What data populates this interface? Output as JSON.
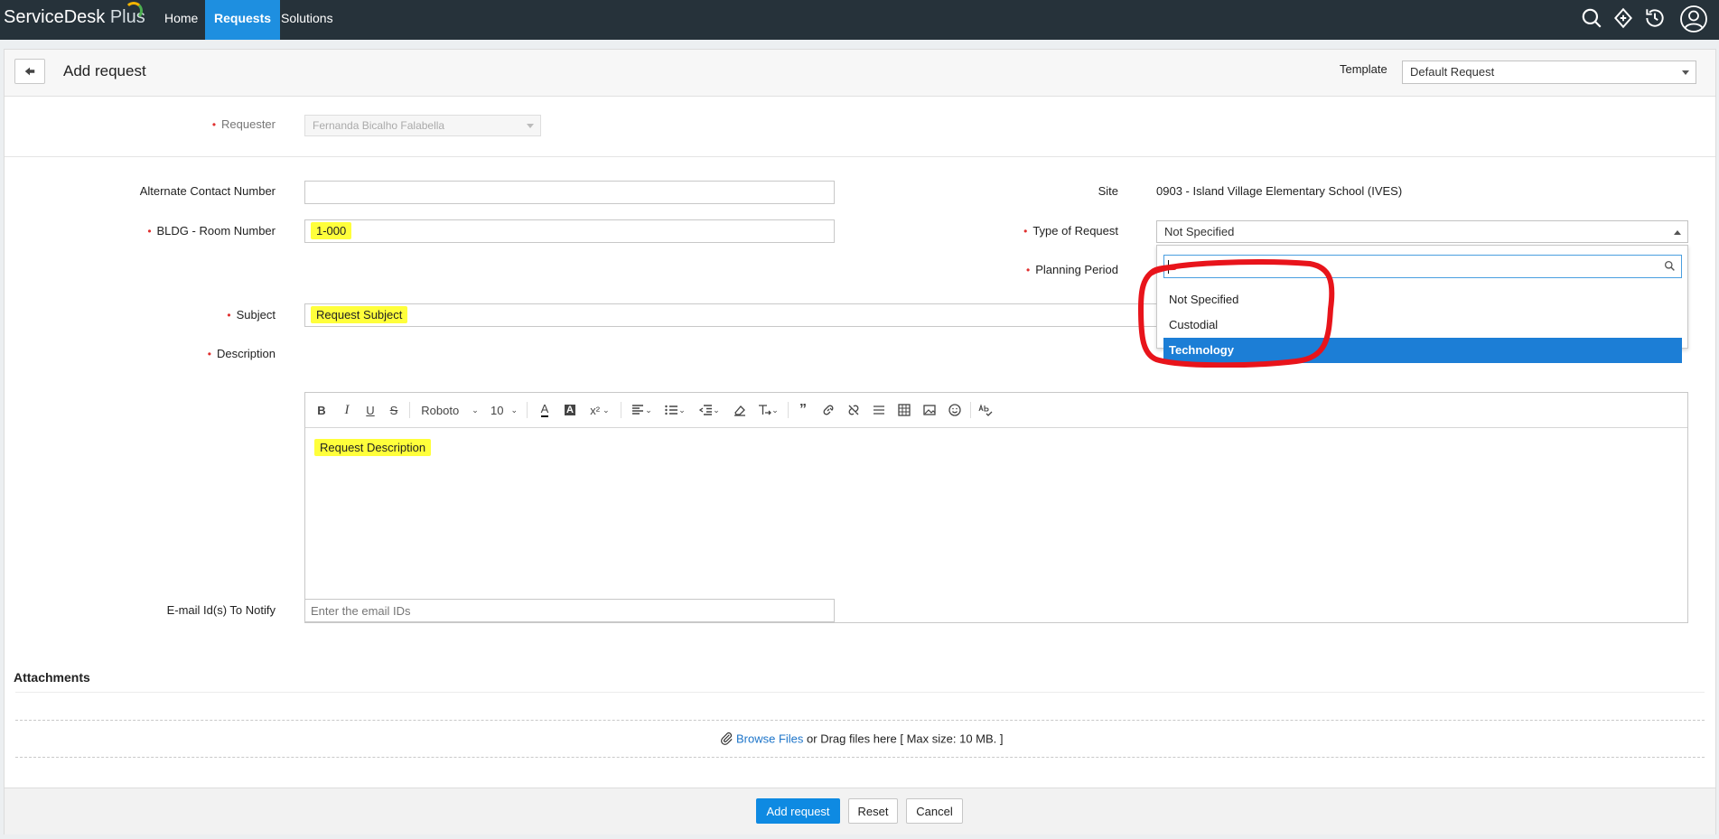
{
  "app": {
    "logo_name": "ServiceDesk",
    "logo_plus": "Plus",
    "nav": [
      "Home",
      "Requests",
      "Solutions"
    ],
    "active_nav": "Requests"
  },
  "header": {
    "title": "Add request",
    "template_label": "Template",
    "template_value": "Default Request"
  },
  "form": {
    "requester_label": "Requester",
    "requester_value": "Fernanda Bicalho Falabella",
    "alt_contact_label": "Alternate Contact Number",
    "alt_contact_value": "",
    "room_label": "BLDG - Room Number",
    "room_value": "1-000",
    "site_label": "Site",
    "site_value": "0903 - Island Village Elementary School (IVES)",
    "type_label": "Type of Request",
    "type_value": "Not Specified",
    "planning_label": "Planning Period",
    "subject_label": "Subject",
    "subject_value": "Request Subject",
    "description_label": "Description",
    "description_value": "Request Description",
    "email_label": "E-mail Id(s) To Notify",
    "email_placeholder": "Enter the email IDs"
  },
  "toolbar": {
    "font_name": "Roboto",
    "font_size": "10"
  },
  "dropdown": {
    "search_value": "",
    "options": [
      "Not Specified",
      "Custodial",
      "Technology"
    ],
    "selected": "Technology"
  },
  "attachments": {
    "title": "Attachments",
    "browse_label": "Browse Files",
    "drop_text": " or Drag files here [ Max size: 10 MB. ]"
  },
  "footer": {
    "add_label": "Add request",
    "reset_label": "Reset",
    "cancel_label": "Cancel"
  },
  "colors": {
    "topbar": "#26323a",
    "accent": "#1e8fe0",
    "highlight": "#ffff3b",
    "annotation": "#e8141b",
    "required": "#e0302f"
  }
}
